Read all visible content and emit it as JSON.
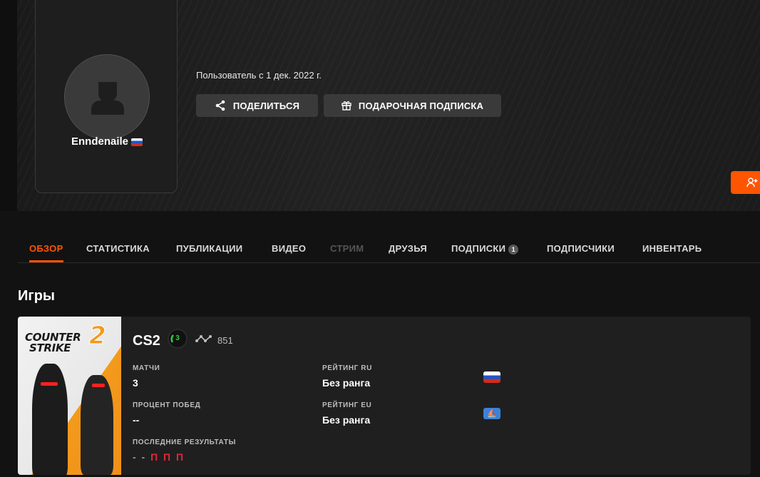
{
  "profile": {
    "username": "Enndenaile",
    "country": "RU",
    "member_since": "Пользователь с 1 дек. 2022 г."
  },
  "actions": {
    "share_label": "ПОДЕЛИТЬСЯ",
    "gift_label": "ПОДАРОЧНАЯ ПОДПИСКА"
  },
  "tabs": [
    {
      "label": "ОБЗОР",
      "state": "active"
    },
    {
      "label": "СТАТИСТИКА",
      "state": "normal"
    },
    {
      "label": "ПУБЛИКАЦИИ",
      "state": "normal"
    },
    {
      "label": "ВИДЕО",
      "state": "normal"
    },
    {
      "label": "СТРИМ",
      "state": "disabled"
    },
    {
      "label": "ДРУЗЬЯ",
      "state": "normal"
    },
    {
      "label": "ПОДПИСКИ",
      "state": "normal",
      "badge": "1"
    },
    {
      "label": "ПОДПИСЧИКИ",
      "state": "normal"
    },
    {
      "label": "ИНВЕНТАРЬ",
      "state": "normal"
    }
  ],
  "games_section": {
    "title": "Игры"
  },
  "game": {
    "cover_title_line1": "COUNTER",
    "cover_title_line2": "STRIKE",
    "cover_title_number": "2",
    "name": "CS2",
    "level": "3",
    "elo": "851",
    "matches_label": "МАТЧИ",
    "matches_value": "3",
    "winrate_label": "ПРОЦЕНТ ПОБЕД",
    "winrate_value": "--",
    "recent_label": "ПОСЛЕДНИЕ РЕЗУЛЬТАТЫ",
    "recent_dashes": "- -",
    "recent_losses": "П П П",
    "rating_ru_label": "РЕЙТИНГ RU",
    "rating_ru_value": "Без ранга",
    "rating_eu_label": "РЕЙТИНГ EU",
    "rating_eu_value": "Без ранга"
  },
  "colors": {
    "accent": "#ff5500",
    "loss": "#e0283c",
    "level": "#2ecc40"
  },
  "icons": [
    "user-placeholder-icon",
    "share-icon",
    "gift-icon",
    "add-friend-icon",
    "elo-icon",
    "ru-flag-icon",
    "eu-region-icon"
  ]
}
